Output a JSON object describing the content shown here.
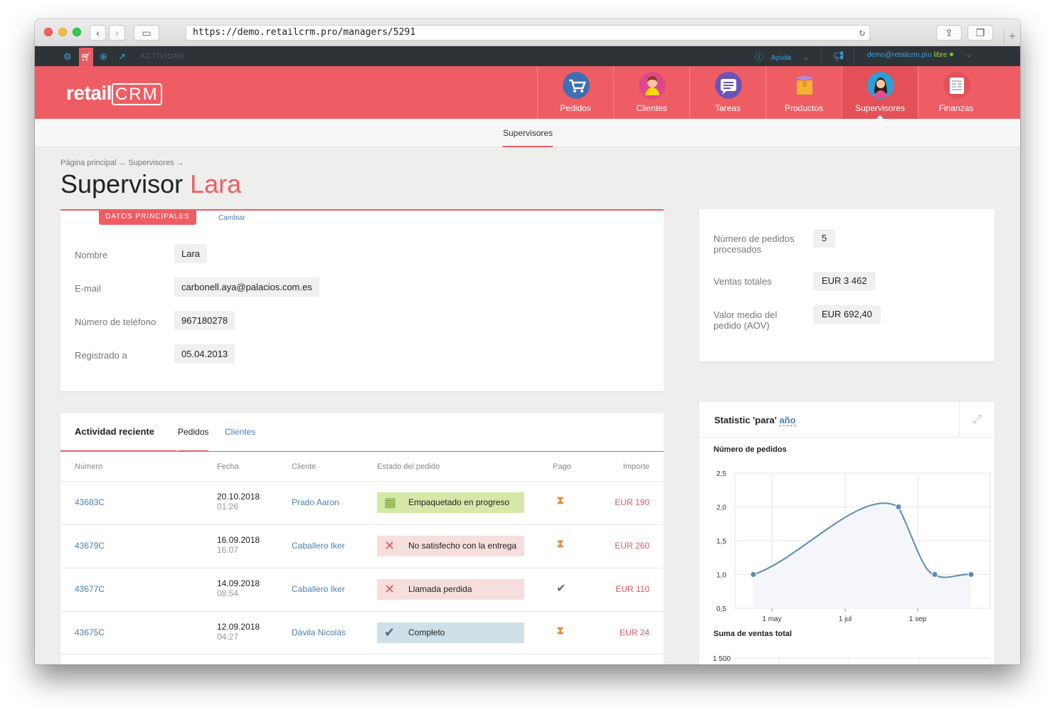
{
  "browser": {
    "url": "https://demo.retailcrm.pro/managers/5291"
  },
  "topbar": {
    "activity_label": "ACTIVIDAD",
    "help_label": "Ayuda",
    "user_email": "demo@retailcrm.pro",
    "user_status": "libre"
  },
  "header": {
    "logo_text": "retail",
    "logo_crm": "CRM",
    "modules": [
      {
        "label": "Pedidos",
        "icon": "cart-icon",
        "color": "#3d6fb5"
      },
      {
        "label": "Clientes",
        "icon": "customer-icon",
        "color": "#e0478a"
      },
      {
        "label": "Tareas",
        "icon": "tasks-icon",
        "color": "#6a54b8"
      },
      {
        "label": "Productos",
        "icon": "box-icon",
        "color": "#f0a830"
      },
      {
        "label": "Supervisores",
        "icon": "supervisor-icon",
        "color": "#2e9ed6"
      },
      {
        "label": "Finanzas",
        "icon": "finance-icon",
        "color": "#e35058"
      }
    ],
    "active_module": "Supervisores"
  },
  "subnav": {
    "item": "Supervisores"
  },
  "breadcrumb": "Página principal → Supervisores →",
  "title": {
    "prefix": "Supervisor",
    "name": "Lara"
  },
  "main_card": {
    "tab_label": "DATOS PRINCIPALES",
    "change_link": "Cambiar",
    "fields": [
      {
        "label": "Nombre",
        "value": "Lara"
      },
      {
        "label": "E-mail",
        "value": "carbonell.aya@palacios.com.es"
      },
      {
        "label": "Número de teléfono",
        "value": "967180278"
      },
      {
        "label": "Registrado a",
        "value": "05.04.2013"
      }
    ]
  },
  "stats": [
    {
      "label": "Número de pedidos procesados",
      "value": "5"
    },
    {
      "label": "Ventas totales",
      "value": "EUR 3 462"
    },
    {
      "label": "Valor medio del pedido (AOV)",
      "value": "EUR 692,40"
    }
  ],
  "activity": {
    "title": "Actividad reciente",
    "tabs": [
      "Pedidos",
      "Clientes"
    ],
    "columns": [
      "Número",
      "Fecha",
      "Cliente",
      "Estado del pedido",
      "Pago",
      "Importe"
    ],
    "rows": [
      {
        "number": "43683C",
        "date": "20.10.2018",
        "time": "01:26",
        "client": "Prado Aaron",
        "status": "Empaquetado en progreso",
        "status_icon": "boxes-icon",
        "status_bg": "#d6e8a8",
        "status_icon_color": "#7ea63a",
        "payment_icon": "hourglass-icon",
        "amount": "EUR 190"
      },
      {
        "number": "43679C",
        "date": "16.09.2018",
        "time": "16:07",
        "client": "Caballero Iker",
        "status": "No satisfecho con la entrega",
        "status_icon": "cross-icon",
        "status_bg": "#f6dedd",
        "status_icon_color": "#e25a60",
        "payment_icon": "hourglass-icon",
        "amount": "EUR 260"
      },
      {
        "number": "43677C",
        "date": "14.09.2018",
        "time": "08:54",
        "client": "Caballero Iker",
        "status": "Llamada perdida",
        "status_icon": "cross-icon",
        "status_bg": "#f6dedd",
        "status_icon_color": "#e25a60",
        "payment_icon": "check-icon",
        "amount": "EUR 110"
      },
      {
        "number": "43675C",
        "date": "12.09.2018",
        "time": "04:27",
        "client": "Dávila Nicolás",
        "status": "Completo",
        "status_icon": "check-icon",
        "status_bg": "#cfe0e8",
        "status_icon_color": "#4a6f8a",
        "payment_icon": "hourglass-icon",
        "amount": "EUR 24"
      }
    ]
  },
  "chart_panel": {
    "title_prefix": "Statistic 'para'",
    "title_period": "año",
    "subtitle_orders": "Número de pedidos",
    "subtitle_sales": "Suma de ventas total"
  },
  "chart_data": [
    {
      "type": "line",
      "title": "Número de pedidos",
      "xlabel": "",
      "ylabel": "",
      "x": [
        "2018-04",
        "2018-08",
        "2018-09",
        "2018-10"
      ],
      "x_tick_labels": [
        "1 may",
        "1 jul",
        "1 sep"
      ],
      "series": [
        {
          "values": [
            1.0,
            2.0,
            1.0,
            1.0
          ]
        }
      ],
      "y_tick_labels": [
        "2,5",
        "2,0",
        "1,5",
        "1,0",
        "0,5"
      ],
      "ylim": [
        0.5,
        2.5
      ],
      "grid": true,
      "color": "#5b8ab8"
    },
    {
      "type": "line",
      "title": "Suma de ventas total",
      "y_tick_labels": [
        "1 500"
      ],
      "grid": true
    }
  ]
}
